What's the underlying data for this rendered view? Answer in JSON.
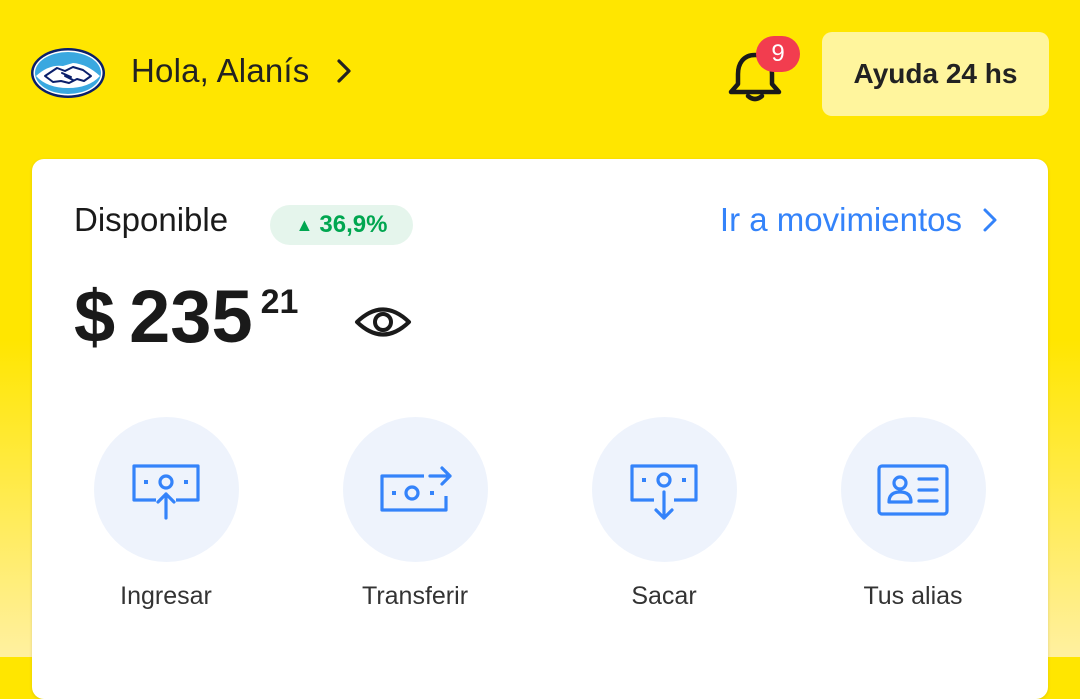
{
  "header": {
    "greeting": "Hola, Alanís",
    "notification_count": "9",
    "help_label": "Ayuda 24 hs"
  },
  "balance_card": {
    "label": "Disponible",
    "percent_change": "36,9%",
    "movements_link": "Ir a movimientos",
    "currency": "$",
    "amount": "235",
    "cents": "21"
  },
  "actions": [
    {
      "label": "Ingresar",
      "icon": "deposit-icon"
    },
    {
      "label": "Transferir",
      "icon": "transfer-icon"
    },
    {
      "label": "Sacar",
      "icon": "withdraw-icon"
    },
    {
      "label": "Tus alias",
      "icon": "alias-card-icon"
    }
  ],
  "colors": {
    "brand_yellow": "#ffe600",
    "link_blue": "#3483fa",
    "icon_blue": "#3483fa",
    "positive_green": "#00a650",
    "badge_red": "#f23d4f"
  }
}
